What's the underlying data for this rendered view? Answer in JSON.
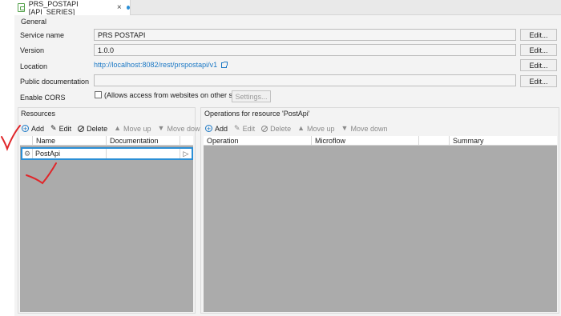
{
  "tab": {
    "title": "PRS_POSTAPI [API_SERIES]",
    "close": "×"
  },
  "general": {
    "group_title": "General",
    "service_name": {
      "label": "Service name",
      "value": "PRS POSTAPI",
      "button": "Edit..."
    },
    "version": {
      "label": "Version",
      "value": "1.0.0",
      "button": "Edit..."
    },
    "location": {
      "label": "Location",
      "url": "http://localhost:8082/rest/prspostapi/v1",
      "button": "Edit..."
    },
    "public_documentation": {
      "label": "Public documentation",
      "value": "",
      "button": "Edit..."
    },
    "cors": {
      "label": "Enable CORS",
      "checkbox_label": "(Allows access from websites on other servers)",
      "settings_button": "Settings..."
    }
  },
  "resources": {
    "group_title": "Resources",
    "toolbar": {
      "add": "Add",
      "edit": "Edit",
      "delete": "Delete",
      "move_up": "Move up",
      "move_down": "Move down"
    },
    "columns": [
      "Name",
      "Documentation"
    ],
    "rows": [
      {
        "name": "PostApi",
        "documentation": ""
      }
    ]
  },
  "operations": {
    "group_title": "Operations for resource 'PostApi'",
    "toolbar": {
      "add": "Add",
      "edit": "Edit",
      "delete": "Delete",
      "move_up": "Move up",
      "move_down": "Move down"
    },
    "columns": [
      "Operation",
      "Microflow",
      "",
      "Summary"
    ]
  },
  "icons": {
    "tab_icon": "published-rest-service-icon",
    "add": "plus-circle-icon",
    "edit": "pencil-icon",
    "delete": "prohibited-icon",
    "move_up": "triangle-up-icon",
    "move_down": "triangle-down-icon",
    "external_link": "external-link-icon",
    "resource_row": "resource-icon",
    "row_play": "play-triangle-icon"
  },
  "colors": {
    "accent": "#2b8fd6",
    "link": "#1b78c5",
    "annotation": "#e0262a",
    "grid_bg": "#ababab"
  }
}
